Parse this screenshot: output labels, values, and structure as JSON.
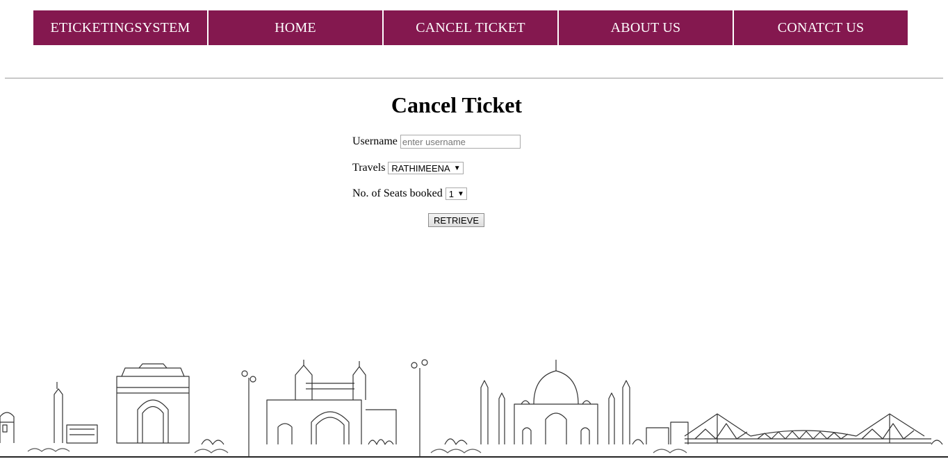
{
  "nav": {
    "items": [
      {
        "label": "ETICKETINGSYSTEM"
      },
      {
        "label": "HOME"
      },
      {
        "label": "CANCEL TICKET"
      },
      {
        "label": "ABOUT US"
      },
      {
        "label": "CONATCT US"
      }
    ]
  },
  "page": {
    "title": "Cancel Ticket"
  },
  "form": {
    "username_label": "Username",
    "username_placeholder": "enter username",
    "username_value": "",
    "travels_label": "Travels",
    "travels_selected": "RATHIMEENA",
    "seats_label": "No. of Seats booked",
    "seats_selected": "1",
    "retrieve_label": "RETRIEVE"
  },
  "colors": {
    "nav_bg": "#84184f",
    "nav_text": "#ffffff"
  },
  "icons": {
    "dropdown": "caret-down-icon",
    "skyline": "city-skyline-illustration"
  }
}
